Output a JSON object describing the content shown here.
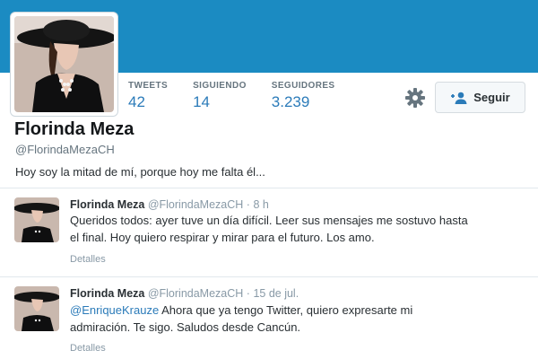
{
  "profile": {
    "name": "Florinda Meza",
    "handle": "@FlorindaMezaCH",
    "bio": "Hoy soy la mitad de mí, porque hoy me falta él..."
  },
  "stats": [
    {
      "label": "TWEETS",
      "value": "42"
    },
    {
      "label": "SIGUIENDO",
      "value": "14"
    },
    {
      "label": "SEGUIDORES",
      "value": "3.239"
    }
  ],
  "follow_button": {
    "label": "Seguir",
    "icon": "add-user-icon"
  },
  "settings_icon": "gear-icon",
  "colors": {
    "banner": "#1b8bc2",
    "link": "#2b7bb9",
    "muted": "#8899a6"
  },
  "tweets": [
    {
      "name": "Florinda Meza",
      "handle": "@FlorindaMezaCH",
      "separator": "·",
      "time": "8 h",
      "mention": "",
      "line1": "Queridos todos: ayer tuve un día difícil. Leer sus mensajes me sostuvo hasta",
      "line2": "el final. Hoy quiero respirar y mirar para el futuro. Los amo.",
      "details": "Detalles"
    },
    {
      "name": "Florinda Meza",
      "handle": "@FlorindaMezaCH",
      "separator": "·",
      "time": "15 de jul.",
      "mention": "@EnriqueKrauze",
      "line1": " Ahora que ya tengo Twitter, quiero expresarte mi",
      "line2": "admiración. Te sigo. Saludos desde Cancún.",
      "details": "Detalles"
    }
  ]
}
